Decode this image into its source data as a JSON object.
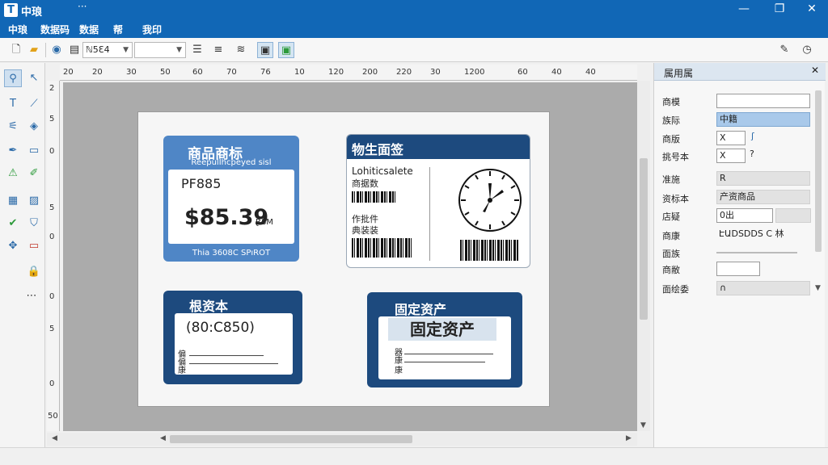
{
  "window": {
    "title": "中琅",
    "title_extra": "···",
    "logo": "T",
    "controls": {
      "minimize": "—",
      "maximize": "❐",
      "close": "✕"
    }
  },
  "menu": {
    "items": [
      "中琅",
      "数据码",
      "数据",
      "帮",
      "我印"
    ]
  },
  "toolbar": {
    "font_select": "ℕ5Ɛ4",
    "size_select": "",
    "icons": [
      "new-file-icon",
      "open-folder-icon",
      "save-icon",
      "print-icon",
      "align-icon",
      "distribute-icon",
      "format-icon",
      "frame-icon",
      "green-frame-icon",
      "pen-icon",
      "clock-icon"
    ]
  },
  "palette": {
    "icons": [
      "select-icon",
      "pointer-icon",
      "text-icon",
      "line-icon",
      "barcode-icon",
      "shape-icon",
      "pen-icon",
      "eraser-icon",
      "chart-icon",
      "brush-icon",
      "table-icon",
      "image-icon",
      "check-icon",
      "shield-icon",
      "move-icon",
      "monitor-icon",
      "lock-icon"
    ],
    "more": "⋯"
  },
  "ruler": {
    "top_ticks": [
      "20",
      "20",
      "30",
      "50",
      "60",
      "70",
      "76",
      "10",
      "120",
      "200",
      "220",
      "30",
      "1200",
      "60",
      "40",
      "40"
    ],
    "left_ticks": [
      "2",
      "5",
      "0",
      "5",
      "0",
      "0",
      "5",
      "0",
      "50"
    ]
  },
  "labels": {
    "price": {
      "title": "商品商标",
      "sub": "ReepulIhcpeyed sisl",
      "code": "PF885",
      "price": "$85.39",
      "unit": "Ɽ8M",
      "foot": "Thia 3608C SPıROT"
    },
    "logistics": {
      "title": "物生面签",
      "line1": "Lohiticsalete",
      "line2": "商据数",
      "line3": "作批件",
      "line4": "典装装"
    },
    "asset1": {
      "title": "根资本",
      "code": "(80:C850)",
      "f1": "偏",
      "f2": "偏",
      "f3": "康"
    },
    "asset2": {
      "title": "固定资产",
      "highlight": "固定资产",
      "f1": "器",
      "f2": "康",
      "f3": "康"
    }
  },
  "panel": {
    "title": "属用属",
    "close": "✕",
    "rows": [
      {
        "label": "商模",
        "value": ""
      },
      {
        "label": "族际",
        "value": "中籍"
      },
      {
        "label": "商版",
        "value": "X"
      },
      {
        "label": "挑号本",
        "value": "X"
      },
      {
        "label": "准施",
        "value": "R"
      },
      {
        "label": "资标本",
        "value": "产资商品"
      },
      {
        "label": "店疑",
        "value": "0出"
      },
      {
        "label": "商康",
        "value": "ԷԱDSDDS C 林"
      },
      {
        "label": "面族",
        "value": ""
      },
      {
        "label": "商敝",
        "value": ""
      },
      {
        "label": "面绘委",
        "value": "∩"
      }
    ]
  }
}
